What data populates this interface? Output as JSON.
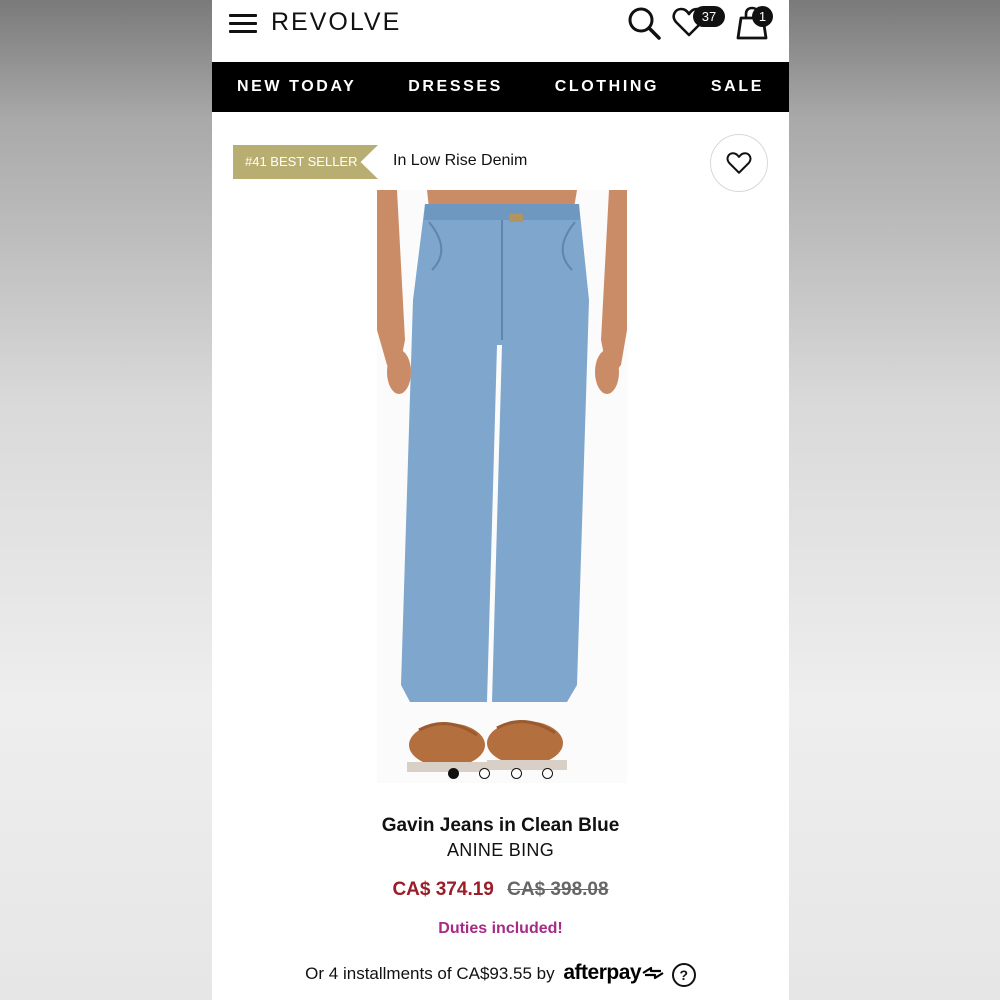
{
  "header": {
    "logo": "REVOLVE",
    "wishlist_count": "37",
    "bag_count": "1"
  },
  "nav": {
    "items": [
      "NEW TODAY",
      "DRESSES",
      "CLOTHING",
      "SALE"
    ]
  },
  "product": {
    "best_seller": "#41 BEST SELLER",
    "category": "In Low Rise Denim",
    "image_icon": "jeans-product-image",
    "carousel": {
      "total": 4,
      "active": 1
    },
    "title": "Gavin Jeans in Clean Blue",
    "brand": "ANINE BING",
    "sale_price": "CA$ 374.19",
    "original_price": "CA$ 398.08",
    "duties": "Duties included!",
    "installments_text": "Or 4 installments of CA$93.55 by",
    "afterpay_label": "afterpay",
    "help_symbol": "?"
  },
  "colors": {
    "ribbon": "#b8ae71",
    "sale_price": "#9b1d28",
    "duties": "#a62a86",
    "nav_bg": "#000000"
  }
}
